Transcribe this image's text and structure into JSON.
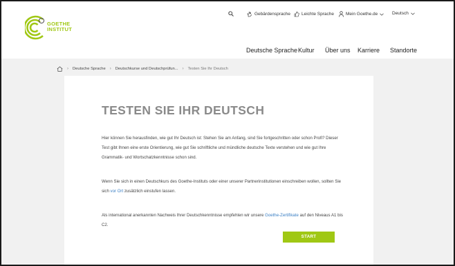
{
  "brand": {
    "line1": "GOETHE",
    "line2": "INSTITUT",
    "color": "#a0c814"
  },
  "utility_nav": {
    "search_icon": "search-icon",
    "sign_language": "Gebärdensprache",
    "easy_language": "Leichte Sprache",
    "my_goethe": "Mein Goethe.de",
    "language": "Deutsch"
  },
  "main_nav": [
    {
      "label": "Deutsche Sprache"
    },
    {
      "label": "Kultur"
    },
    {
      "label": "Über uns"
    },
    {
      "label": "Karriere"
    },
    {
      "label": "Standorte"
    }
  ],
  "breadcrumb": {
    "home_icon": "home-icon",
    "items": [
      "Deutsche Sprache",
      "Deutschkurse und Deutschprüfun...",
      "Testen Sie Ihr Deutsch"
    ]
  },
  "content": {
    "title": "TESTEN SIE IHR DEUTSCH",
    "p1": "Hier können Sie herausfinden, wie gut Ihr Deutsch ist: Stehen Sie am Anfang, sind Sie fortgeschritten oder schon Profi? Dieser Test gibt Ihnen eine erste Orientierung, wie gut Sie schriftliche und mündliche deutsche Texte verstehen und wie gut Ihre Grammatik- und Wortschatzkenntnisse schon sind.",
    "p2_before": "Wenn Sie sich in einen Deutschkurs des Goethe-Instituts oder einer unserer Partnerinstitutionen einschreiben wollen, sollten Sie sich ",
    "p2_link": "vor Ort",
    "p2_after": " zusätzlich einstufen lassen.",
    "p3_before": "Als international anerkannten Nachweis Ihrer Deutschkenntnisse empfehlen wir unsere ",
    "p3_link": "Goethe-Zertifikate",
    "p3_after": " auf den Niveaus A1 bis C2.",
    "start_button": "START"
  }
}
